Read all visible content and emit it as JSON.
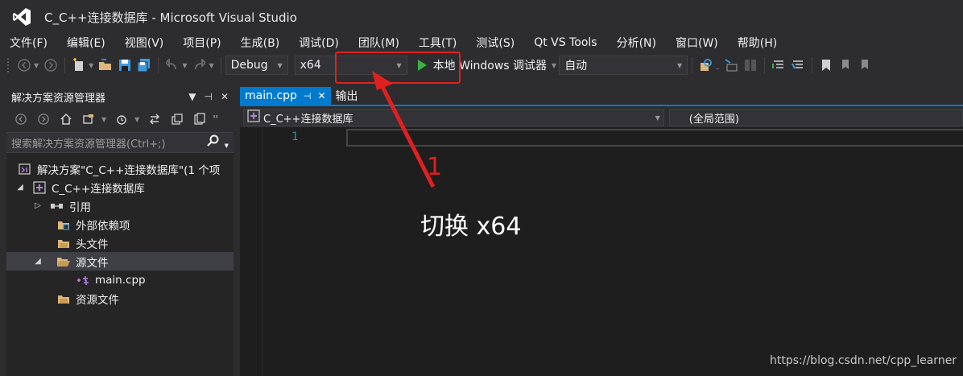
{
  "window": {
    "title": "C_C++连接数据库 - Microsoft Visual Studio"
  },
  "menu": [
    "文件(F)",
    "编辑(E)",
    "视图(V)",
    "项目(P)",
    "生成(B)",
    "调试(D)",
    "团队(M)",
    "工具(T)",
    "测试(S)",
    "Qt VS Tools",
    "分析(N)",
    "窗口(W)",
    "帮助(H)"
  ],
  "toolbar": {
    "configuration": "Debug",
    "platform": "x64",
    "run_label": "本地 Windows 调试器",
    "run_mode": "自动"
  },
  "solution_explorer": {
    "title": "解决方案资源管理器",
    "search_placeholder": "搜索解决方案资源管理器(Ctrl+;)",
    "tree": [
      {
        "label": "解决方案\"C_C++连接数据库\"(1 个项",
        "indent": 0,
        "expander": "",
        "icon": "solution-icon"
      },
      {
        "label": "C_C++连接数据库",
        "indent": 1,
        "expander": "◢",
        "icon": "project-icon"
      },
      {
        "label": "引用",
        "indent": 2,
        "expander": "▷",
        "icon": "references-icon"
      },
      {
        "label": "外部依赖项",
        "indent": 2,
        "expander": "",
        "icon": "external-deps-icon"
      },
      {
        "label": "头文件",
        "indent": 2,
        "expander": "",
        "icon": "folder-icon"
      },
      {
        "label": "源文件",
        "indent": 2,
        "expander": "◢",
        "icon": "folder-icon",
        "selected": true
      },
      {
        "label": "main.cpp",
        "indent": 3,
        "expander": "",
        "icon": "cpp-file-icon"
      },
      {
        "label": "资源文件",
        "indent": 2,
        "expander": "",
        "icon": "folder-icon"
      }
    ]
  },
  "editor": {
    "tabs": [
      {
        "label": "main.cpp",
        "active": true
      },
      {
        "label": "输出",
        "active": false
      }
    ],
    "nav_project": "C_C++连接数据库",
    "nav_scope": "(全局范围)",
    "line_number": "1"
  },
  "annotation": {
    "number": "1",
    "text": "切换 x64",
    "color": "#e02020"
  },
  "watermark": "https://blog.csdn.net/cpp_learner",
  "colors": {
    "accent": "#007acc",
    "background": "#2d2d30",
    "editor_bg": "#1e1e1e",
    "run_green": "#3cb043"
  }
}
